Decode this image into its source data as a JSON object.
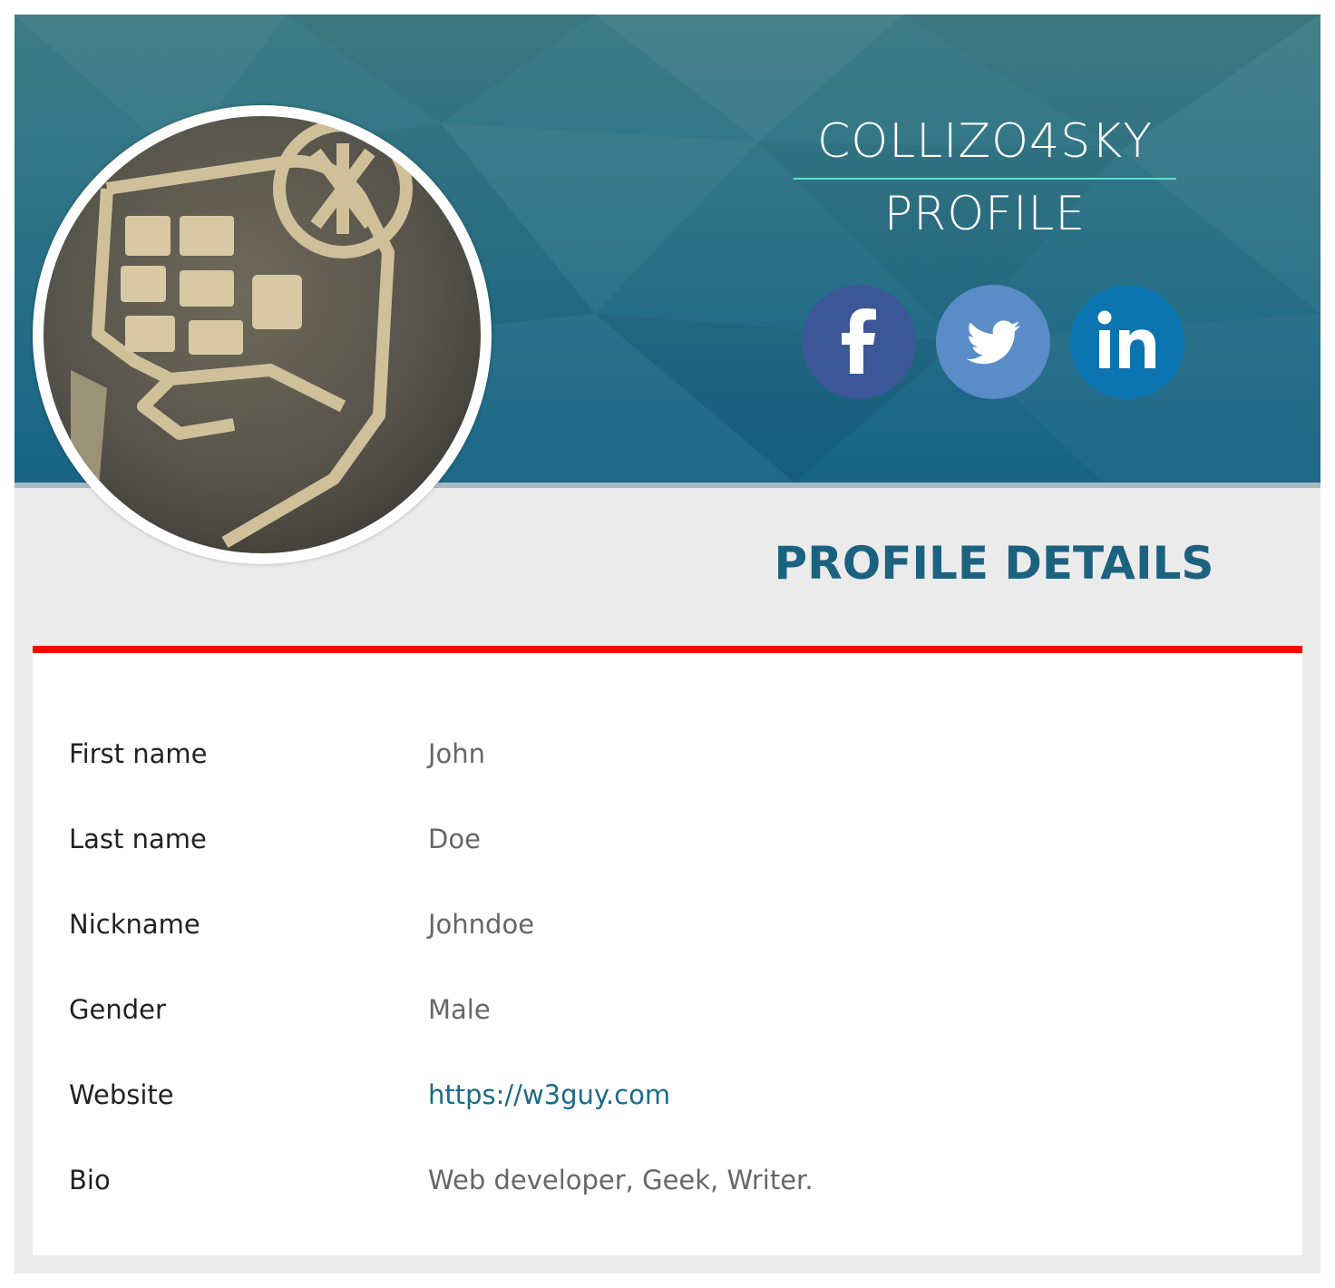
{
  "header": {
    "title_line1": "COLLIZO4SKY",
    "title_line2": "PROFILE",
    "accent_color": "#5fe0d0"
  },
  "social": [
    {
      "name": "facebook",
      "icon": "facebook-icon",
      "color": "#3b5797"
    },
    {
      "name": "twitter",
      "icon": "twitter-icon",
      "color": "#5a8cc9"
    },
    {
      "name": "linkedin",
      "icon": "linkedin-icon",
      "color": "#0b75b2"
    }
  ],
  "avatar": {
    "icon": "profile-photo"
  },
  "details": {
    "heading": "PROFILE DETAILS",
    "divider_color": "#ff0000",
    "rows": [
      {
        "label": "First name",
        "value": "John"
      },
      {
        "label": "Last name",
        "value": "Doe"
      },
      {
        "label": "Nickname",
        "value": "Johndoe"
      },
      {
        "label": "Gender",
        "value": "Male"
      },
      {
        "label": "Website",
        "value": "https://w3guy.com"
      },
      {
        "label": "Bio",
        "value": "Web developer, Geek, Writer."
      }
    ]
  }
}
